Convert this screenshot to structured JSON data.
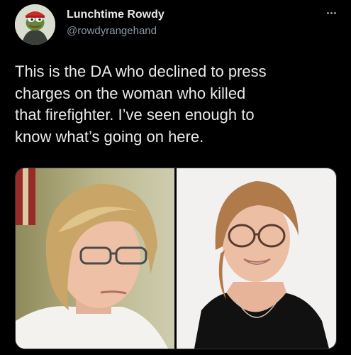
{
  "tweet": {
    "author": {
      "display_name": "Lunchtime Rowdy",
      "handle": "@rowdyrangehand",
      "avatar": "frog-avatar-icon"
    },
    "more_icon": "more-horizontal-icon",
    "text": "This is the DA who declined to press\ncharges on the woman who killed\nthat firefighter. I’ve seen enough to\nknow what’s going on here.",
    "media": [
      {
        "kind": "photo",
        "name": "woman-portrait-left"
      },
      {
        "kind": "photo",
        "name": "woman-portrait-right"
      }
    ]
  },
  "colors": {
    "background": "#000000",
    "text_primary": "#e7e9ea",
    "text_secondary": "#8b98a5",
    "border": "#2f3336"
  }
}
